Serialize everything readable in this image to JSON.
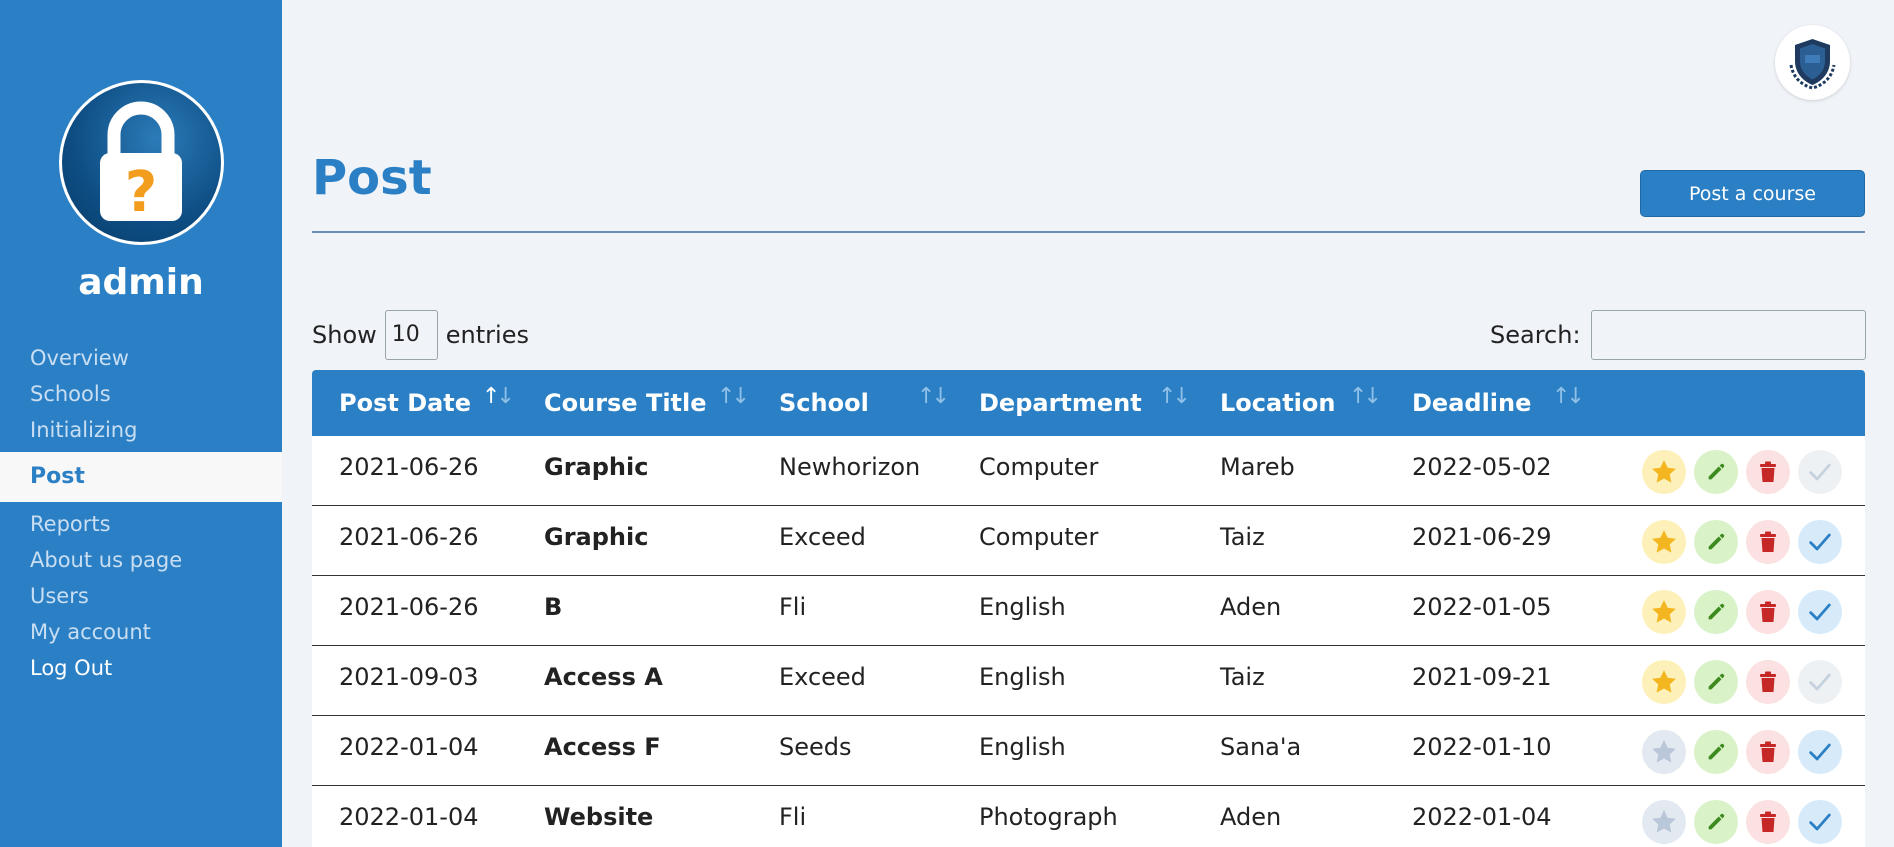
{
  "user": {
    "name": "admin"
  },
  "sidebar": {
    "items": [
      {
        "label": "Overview"
      },
      {
        "label": "Schools"
      },
      {
        "label": "Initializing"
      },
      {
        "label": "Post"
      },
      {
        "label": "Reports"
      },
      {
        "label": "About us page"
      },
      {
        "label": "Users"
      },
      {
        "label": "My account"
      },
      {
        "label": "Log Out"
      }
    ],
    "active": "Post"
  },
  "header": {
    "title": "Post",
    "post_button_label": "Post a course"
  },
  "controls": {
    "show_label": "Show",
    "entries_value": "10",
    "entries_label": "entries",
    "search_label": "Search:",
    "search_value": ""
  },
  "table": {
    "columns": [
      "Post Date",
      "Course Title",
      "School",
      "Department",
      "Location",
      "Deadline"
    ],
    "rows": [
      {
        "post_date": "2021-06-26",
        "course_title": "Graphic",
        "school": "Newhorizon",
        "department": "Computer",
        "location": "Mareb",
        "deadline": "2022-05-02",
        "featured": true,
        "approved": false
      },
      {
        "post_date": "2021-06-26",
        "course_title": "Graphic",
        "school": "Exceed",
        "department": "Computer",
        "location": "Taiz",
        "deadline": "2021-06-29",
        "featured": true,
        "approved": true
      },
      {
        "post_date": "2021-06-26",
        "course_title": "B",
        "school": "Fli",
        "department": "English",
        "location": "Aden",
        "deadline": "2022-01-05",
        "featured": true,
        "approved": true
      },
      {
        "post_date": "2021-09-03",
        "course_title": "Access A",
        "school": "Exceed",
        "department": "English",
        "location": "Taiz",
        "deadline": "2021-09-21",
        "featured": true,
        "approved": false
      },
      {
        "post_date": "2022-01-04",
        "course_title": "Access F",
        "school": "Seeds",
        "department": "English",
        "location": "Sana'a",
        "deadline": "2022-01-10",
        "featured": false,
        "approved": true
      },
      {
        "post_date": "2022-01-04",
        "course_title": "Website",
        "school": "Fli",
        "department": "Photograph",
        "location": "Aden",
        "deadline": "2022-01-04",
        "featured": false,
        "approved": true
      }
    ]
  },
  "colors": {
    "primary": "#2b80c5",
    "background": "#f0f3f8",
    "star_on": "#f4b620",
    "star_off": "#b9c7d8",
    "edit": "#3d8b1f",
    "delete": "#c62828",
    "check_on": "#2b80c5",
    "check_off": "#c5d2de"
  },
  "icons": {
    "avatar": "lock-question-icon",
    "logo": "shield-crest-icon",
    "featured": "star-icon",
    "edit": "pencil-icon",
    "delete": "trash-icon",
    "approve": "check-icon",
    "sort": "sort-arrows-icon"
  }
}
